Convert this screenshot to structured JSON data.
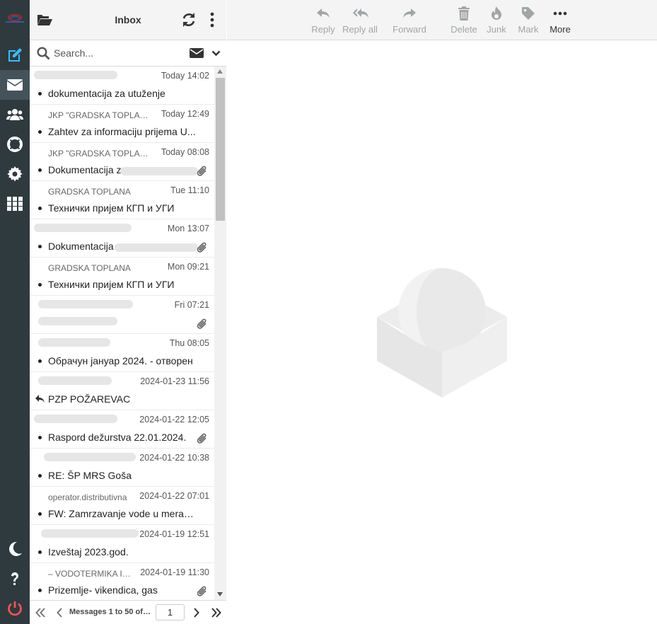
{
  "header": {
    "title": "Inbox"
  },
  "search": {
    "placeholder": "Search..."
  },
  "toolbar": {
    "reply": "Reply",
    "reply_all": "Reply all",
    "forward": "Forward",
    "delete": "Delete",
    "junk": "Junk",
    "mark": "Mark",
    "more": "More"
  },
  "messages": [
    {
      "from": "",
      "date": "Today 14:02",
      "subject": "dokumentacija za utuženje"
    },
    {
      "from": "JKP \"GRADSKA TOPLANA\"",
      "date": "Today 12:49",
      "subject": "Zahtev za informaciju prijema U..."
    },
    {
      "from": "JKP \"GRADSKA TOPLANA\"",
      "date": "Today 08:08",
      "subject": "Dokumentacija za"
    },
    {
      "from": "GRADSKA TOPLANA",
      "date": "Tue 11:10",
      "subject": "Технички пријем КГП и УГИ"
    },
    {
      "from": "",
      "date": "Mon 13:07",
      "subject": "Dokumentacija"
    },
    {
      "from": "GRADSKA TOPLANA",
      "date": "Mon 09:21",
      "subject": "Технички пријем КГП и УГИ"
    },
    {
      "from": "",
      "date": "Fri 07:21",
      "subject": ""
    },
    {
      "from": "",
      "date": "Thu 08:05",
      "subject": "Обрачун јануар 2024. - отворен"
    },
    {
      "from": "",
      "date": "2024-01-23 11:56",
      "subject": "PZP POŽAREVAC"
    },
    {
      "from": "",
      "date": "2024-01-22 12:05",
      "subject": "Raspord dežurstva 22.01.2024."
    },
    {
      "from": "",
      "date": "2024-01-22 10:38",
      "subject": "RE: ŠP MRS Goša"
    },
    {
      "from": "operator.distributivna",
      "date": "2024-01-22 07:01",
      "subject": "FW: Zamrzavanje vode u meracima"
    },
    {
      "from": "",
      "date": "2024-01-19 12:51",
      "subject": "Izveštaj 2023.god."
    },
    {
      "from": "– VODOTERMIKA INŽENJERING",
      "date": "2024-01-19 11:30",
      "subject": "Prizemlje- vikendica, gas"
    }
  ],
  "footer": {
    "count_text": "Messages 1 to 50 of ...",
    "page": "1"
  },
  "colors": {
    "rail": "#2f3a3f",
    "accent": "#37beff",
    "logout": "#ff5552"
  }
}
